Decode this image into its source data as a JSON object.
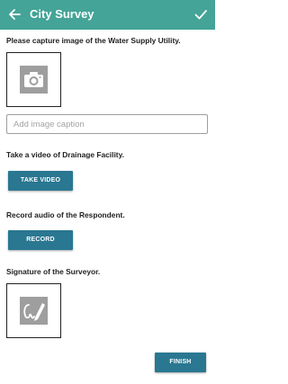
{
  "appbar": {
    "title": "City Survey",
    "back_icon": "arrow-left-icon",
    "confirm_icon": "check-icon",
    "background": "#43a497"
  },
  "water_supply": {
    "label": "Please capture image of the Water Supply Utility.",
    "camera_icon": "camera-icon",
    "caption_placeholder": "Add image caption",
    "caption_value": ""
  },
  "drainage": {
    "label": "Take a video of Drainage Facility.",
    "button_label": "TAKE VIDEO"
  },
  "respondent": {
    "label": "Record audio of the Respondent.",
    "button_label": "RECORD"
  },
  "signature": {
    "label": "Signature of the Surveyor.",
    "signature_icon": "signature-pen-icon"
  },
  "footer": {
    "finish_label": "FINISH"
  },
  "colors": {
    "primary_button": "#2a7791",
    "icon_gray": "#9e9e9e"
  }
}
